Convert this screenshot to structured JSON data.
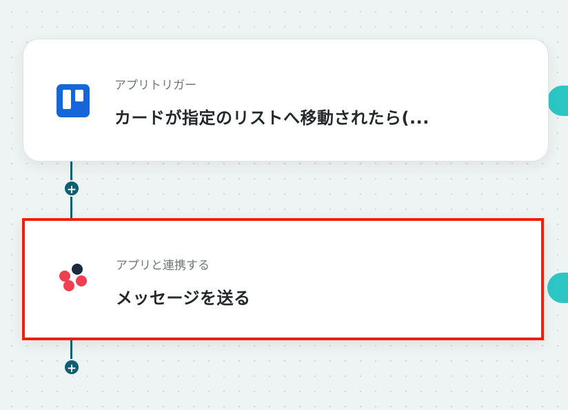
{
  "flow": {
    "trigger": {
      "kind_label": "アプリトリガー",
      "title": "カードが指定のリストへ移動されたら(...",
      "app_icon": "trello-icon",
      "icon_color": "#1466d9"
    },
    "action": {
      "kind_label": "アプリと連携する",
      "title": "メッセージを送る",
      "app_icon": "chatwork-icon",
      "icon_colors": [
        "#f13f52",
        "#1b2a3e"
      ]
    },
    "add_step_symbol": "+"
  },
  "colors": {
    "connector": "#0f5f73",
    "selection_border": "#f01e0a",
    "side_handle": "#2cc7c4",
    "canvas": "#eef3f3"
  }
}
